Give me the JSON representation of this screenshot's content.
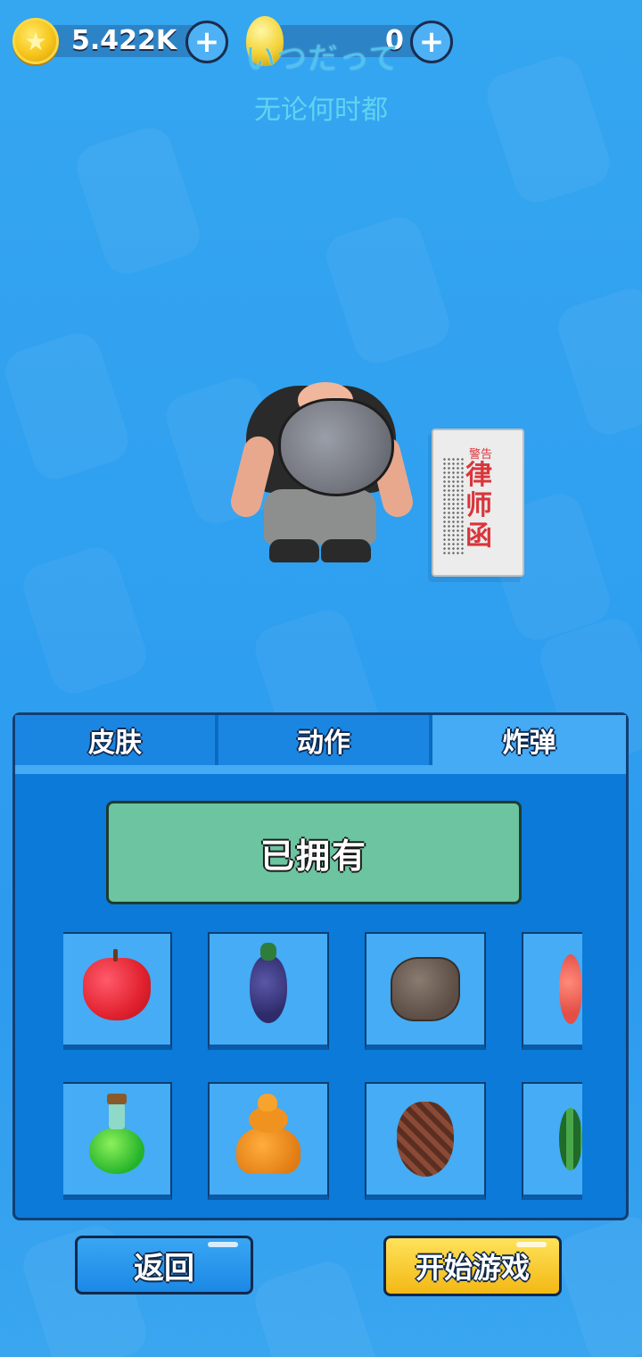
{
  "hud": {
    "coins": "5.422K",
    "gems": "0",
    "coin_icon": "star-coin-icon",
    "gem_icon": "gold-gem-icon",
    "add_icon": "plus-icon"
  },
  "subtitles": {
    "japanese": "いつだって",
    "chinese": "无论何时都"
  },
  "letter": {
    "warning": "警告",
    "title": "律师函"
  },
  "tabs": [
    {
      "label": "皮肤",
      "selected": false
    },
    {
      "label": "动作",
      "selected": false
    },
    {
      "label": "炸弹",
      "selected": true
    }
  ],
  "status": {
    "owned_label": "已拥有"
  },
  "items": [
    {
      "icon": "apple-icon"
    },
    {
      "icon": "eggplant-icon"
    },
    {
      "icon": "rock-icon"
    },
    {
      "icon": "peach-icon"
    },
    {
      "icon": "potion-icon"
    },
    {
      "icon": "poop-icon"
    },
    {
      "icon": "pinecone-icon"
    },
    {
      "icon": "watermelon-icon"
    }
  ],
  "buttons": {
    "back": "返回",
    "start": "开始游戏"
  },
  "colors": {
    "background": "#2f9ff0",
    "panel": "#0b7ad9",
    "selected_tab": "#44abf4",
    "owned_bg": "#6cc4a0",
    "start_button": "#f3b815"
  }
}
